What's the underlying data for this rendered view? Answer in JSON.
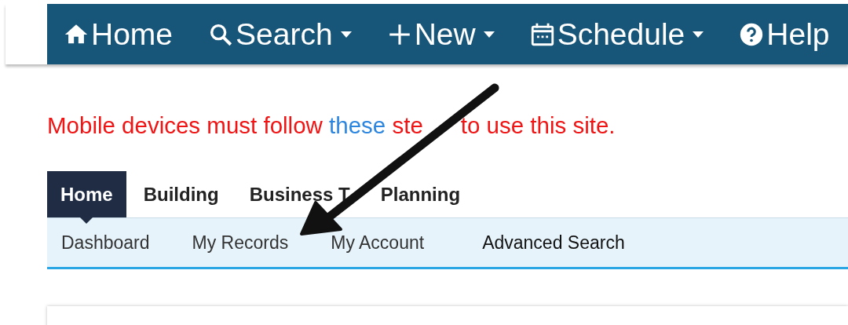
{
  "top_nav": [
    {
      "kind": "home",
      "label": "Home",
      "dropdown": false
    },
    {
      "kind": "search",
      "label": "Search",
      "dropdown": true
    },
    {
      "kind": "new",
      "label": "New",
      "dropdown": true
    },
    {
      "kind": "schedule",
      "label": "Schedule",
      "dropdown": true
    },
    {
      "kind": "help",
      "label": "Help",
      "dropdown": false
    }
  ],
  "notice": {
    "before": "Mobile devices must follow ",
    "link": "these",
    "fragments": [
      " ste",
      "to use this site."
    ]
  },
  "tabs": [
    {
      "label": "Home",
      "selected": true
    },
    {
      "label": "Building",
      "selected": false
    },
    {
      "label": "Business T",
      "selected": false
    },
    {
      "label": "Planning",
      "selected": false
    }
  ],
  "subnav": [
    "Dashboard",
    "My Records",
    "My Account",
    "Advanced Search"
  ]
}
